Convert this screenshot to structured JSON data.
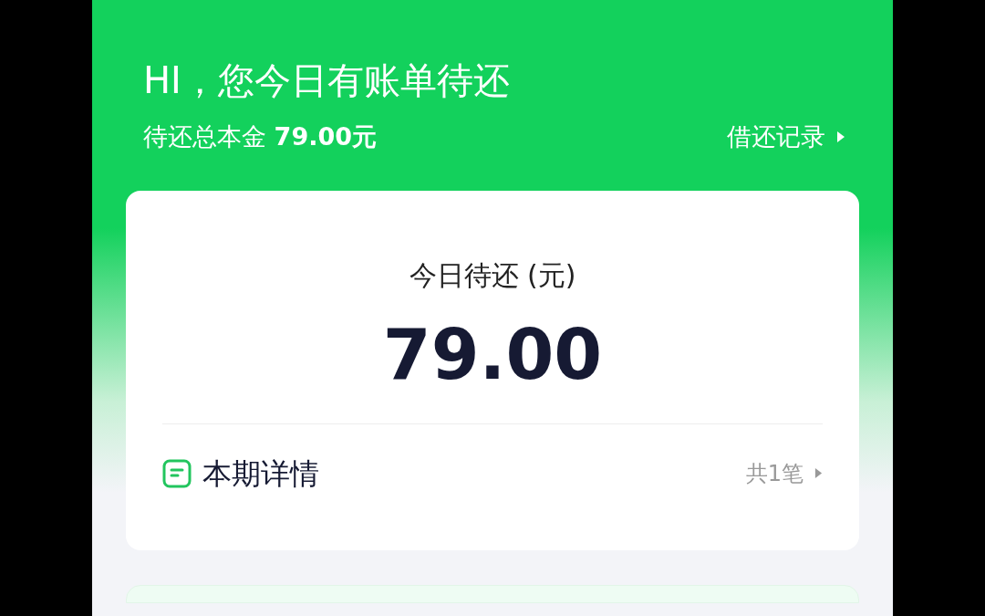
{
  "header": {
    "greeting": "HI，您今日有账单待还",
    "principal_label": "待还总本金",
    "principal_amount": "79.00元",
    "history_link": "借还记录"
  },
  "bill_card": {
    "title": "今日待还 (元)",
    "amount": "79.00",
    "detail_label": "本期详情",
    "count": "共1笔"
  }
}
